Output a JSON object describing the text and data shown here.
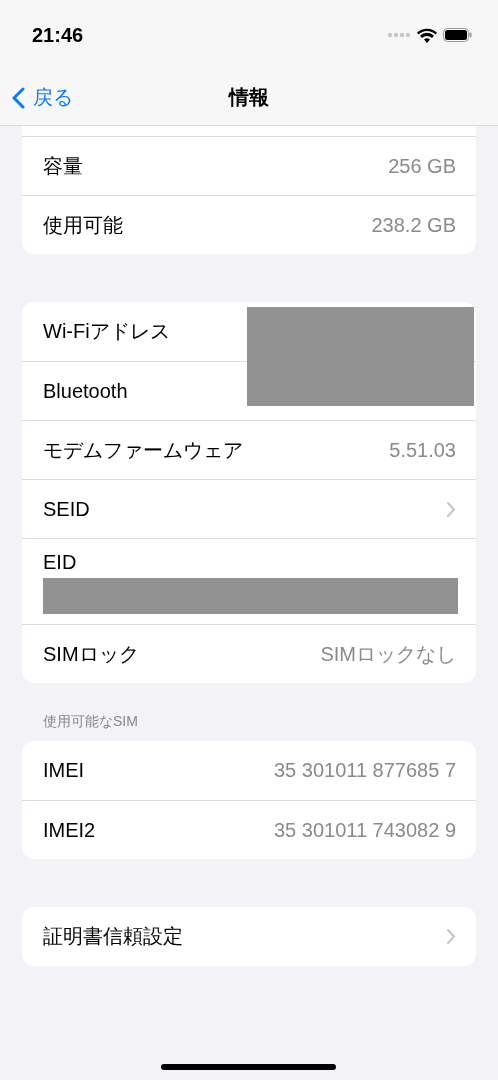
{
  "status_bar": {
    "time": "21:46"
  },
  "nav": {
    "back": "戻る",
    "title": "情報"
  },
  "groups": [
    {
      "clipped_top": true,
      "rows": [
        {
          "kind": "value",
          "label": "容量",
          "value": "256 GB"
        },
        {
          "kind": "value",
          "label": "使用可能",
          "value": "238.2 GB"
        }
      ]
    },
    {
      "masked": true,
      "rows": [
        {
          "kind": "label",
          "label": "Wi-Fiアドレス"
        },
        {
          "kind": "label",
          "label": "Bluetooth"
        },
        {
          "kind": "value",
          "label": "モデムファームウェア",
          "value": "5.51.03"
        },
        {
          "kind": "chevron",
          "label": "SEID"
        },
        {
          "kind": "hidden",
          "label": "EID"
        },
        {
          "kind": "value",
          "label": "SIMロック",
          "value": "SIMロックなし"
        }
      ]
    },
    {
      "header": "使用可能なSIM",
      "rows": [
        {
          "kind": "value",
          "label": "IMEI",
          "value": "35 301011 877685 7"
        },
        {
          "kind": "value",
          "label": "IMEI2",
          "value": "35 301011 743082 9"
        }
      ]
    },
    {
      "rows": [
        {
          "kind": "chevron",
          "label": "証明書信頼設定"
        }
      ]
    }
  ]
}
